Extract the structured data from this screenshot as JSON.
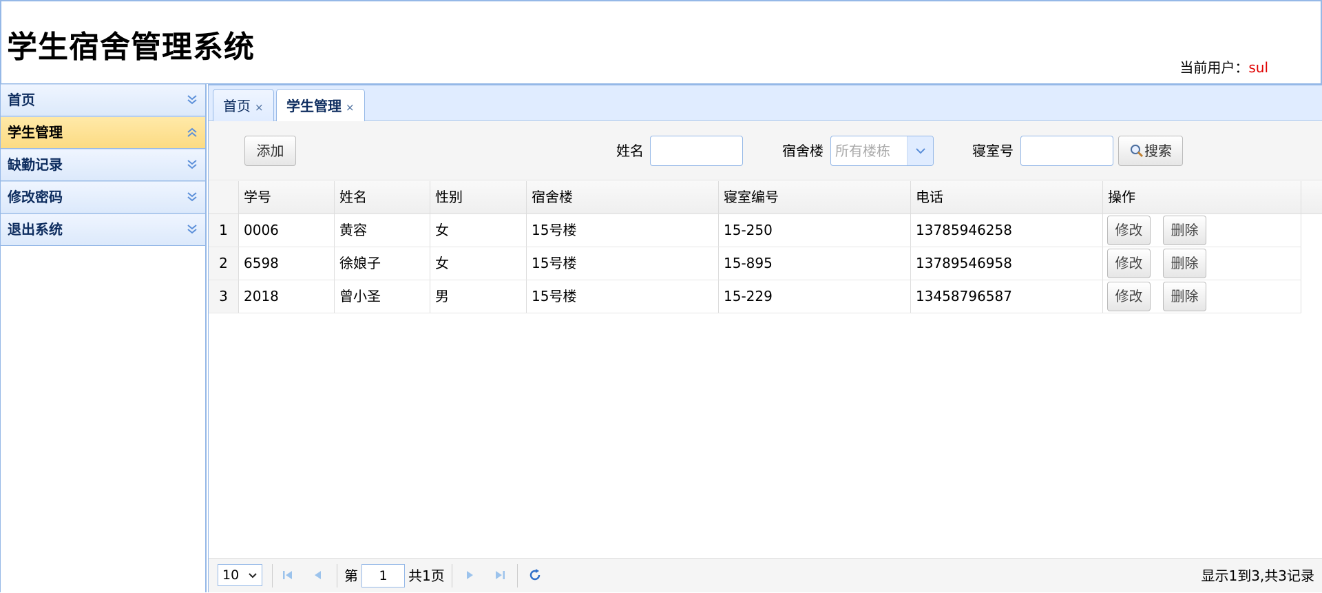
{
  "app": {
    "title": "学生宿舍管理系统"
  },
  "header": {
    "current_user_label": "当前用户：",
    "current_user": "sul"
  },
  "sidebar": {
    "items": [
      {
        "label": "首页",
        "expanded": false
      },
      {
        "label": "学生管理",
        "expanded": true
      },
      {
        "label": "缺勤记录",
        "expanded": false
      },
      {
        "label": "修改密码",
        "expanded": false
      },
      {
        "label": "退出系统",
        "expanded": false
      }
    ]
  },
  "tabs": [
    {
      "label": "首页",
      "close": "×"
    },
    {
      "label": "学生管理",
      "close": "×"
    }
  ],
  "toolbar": {
    "add_label": "添加",
    "name_label": "姓名",
    "name_value": "",
    "building_label": "宿舍楼",
    "building_placeholder": "所有楼栋",
    "room_label": "寝室号",
    "room_value": "",
    "search_label": "搜索"
  },
  "grid": {
    "columns": [
      "学号",
      "姓名",
      "性别",
      "宿舍楼",
      "寝室编号",
      "电话",
      "操作"
    ],
    "rows": [
      {
        "num": "1",
        "id": "0006",
        "name": "黄容",
        "gender": "女",
        "building": "15号楼",
        "room": "15-250",
        "phone": "13785946258"
      },
      {
        "num": "2",
        "id": "6598",
        "name": "徐娘子",
        "gender": "女",
        "building": "15号楼",
        "room": "15-895",
        "phone": "13789546958"
      },
      {
        "num": "3",
        "id": "2018",
        "name": "曾小圣",
        "gender": "男",
        "building": "15号楼",
        "room": "15-229",
        "phone": "13458796587"
      }
    ],
    "edit_label": "修改",
    "delete_label": "删除"
  },
  "pager": {
    "page_size": "10",
    "page_prefix": "第",
    "page_number": "1",
    "page_suffix": "共1页",
    "summary": "显示1到3,共3记录"
  },
  "colors": {
    "border": "#95b8e7",
    "header_bg": "#e0ecff",
    "active_item": "#fcdb83",
    "user_name": "#e00000"
  }
}
